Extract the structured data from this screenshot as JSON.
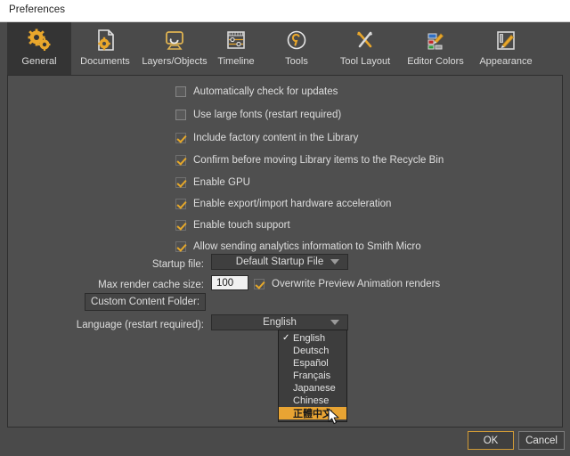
{
  "window": {
    "title": "Preferences"
  },
  "tabs": [
    {
      "label": "General",
      "icon": "gears-icon",
      "active": true
    },
    {
      "label": "Documents",
      "icon": "document-gear-icon",
      "active": false
    },
    {
      "label": "Layers/Objects",
      "icon": "layers-objects-icon",
      "active": false
    },
    {
      "label": "Timeline",
      "icon": "timeline-icon",
      "active": false
    },
    {
      "label": "Tools",
      "icon": "wrench-circle-icon",
      "active": false
    },
    {
      "label": "Tool Layout",
      "icon": "tools-cross-icon",
      "active": false
    },
    {
      "label": "Editor Colors",
      "icon": "color-swatch-pencil-icon",
      "active": false
    },
    {
      "label": "Appearance",
      "icon": "appearance-brush-icon",
      "active": false
    }
  ],
  "checkboxes": [
    {
      "label": "Automatically check for updates",
      "checked": false
    },
    {
      "label": "Use large fonts (restart required)",
      "checked": false
    },
    {
      "label": "Include factory content in the Library",
      "checked": true
    },
    {
      "label": "Confirm before moving Library items to the Recycle Bin",
      "checked": true
    },
    {
      "label": "Enable GPU",
      "checked": true
    },
    {
      "label": "Enable export/import hardware acceleration",
      "checked": true
    },
    {
      "label": "Enable touch support",
      "checked": true
    },
    {
      "label": "Allow sending analytics information to Smith Micro",
      "checked": true
    }
  ],
  "fields": {
    "startup_file": {
      "label": "Startup file:",
      "value": "Default Startup File"
    },
    "max_render_cache": {
      "label": "Max render cache size:",
      "value": "100"
    },
    "overwrite_preview": {
      "label": "Overwrite Preview Animation renders",
      "checked": true
    },
    "custom_content_folder": {
      "label": "Custom Content Folder:"
    },
    "language": {
      "label": "Language (restart required):",
      "value": "English"
    }
  },
  "language_dropdown": {
    "options": [
      {
        "label": "English",
        "checked": true,
        "highlighted": false
      },
      {
        "label": "Deutsch",
        "checked": false,
        "highlighted": false
      },
      {
        "label": "Español",
        "checked": false,
        "highlighted": false
      },
      {
        "label": "Français",
        "checked": false,
        "highlighted": false
      },
      {
        "label": "Japanese",
        "checked": false,
        "highlighted": false
      },
      {
        "label": "Chinese",
        "checked": false,
        "highlighted": false
      },
      {
        "label": "正體中文",
        "checked": false,
        "highlighted": true
      }
    ]
  },
  "footer": {
    "ok_label": "OK",
    "cancel_label": "Cancel"
  },
  "colors": {
    "accent": "#e8a433",
    "checkmark": "#e6a82a",
    "panel_bg": "#4f4f4f",
    "window_bg": "#4a4a4a",
    "active_tab_bg": "#343434",
    "titlebar_bg": "#ffffff"
  }
}
